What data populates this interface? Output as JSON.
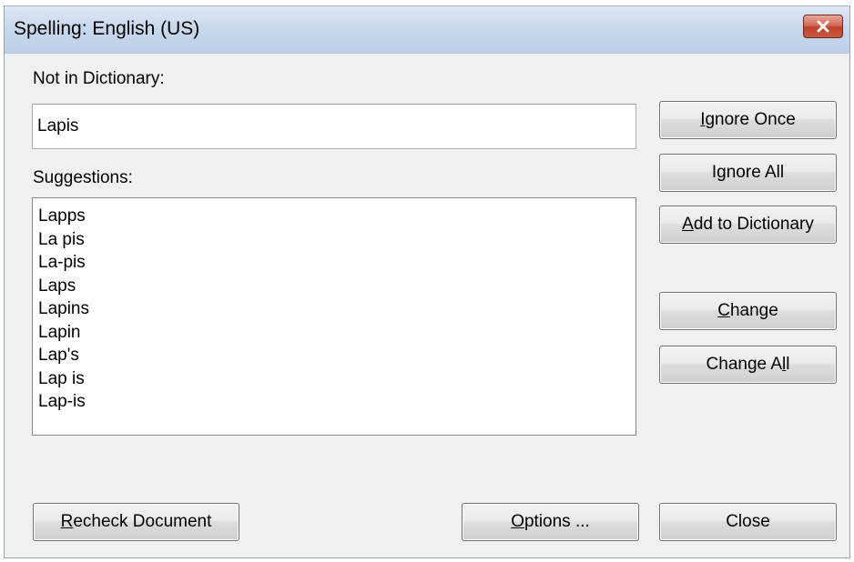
{
  "window": {
    "title": "Spelling: English (US)",
    "close_icon": "close-icon"
  },
  "not_in_dictionary": {
    "label": "Not in Dictionary:",
    "value": "Lapis"
  },
  "suggestions": {
    "label": "Suggestions:",
    "items": [
      "Lapps",
      "La pis",
      "La-pis",
      "Laps",
      "Lapins",
      "Lapin",
      "Lap's",
      "Lap is",
      "Lap-is"
    ]
  },
  "buttons": {
    "ignore_once": {
      "accel": "I",
      "rest": "gnore Once"
    },
    "ignore_all": {
      "pre": "I",
      "accel": "g",
      "rest": "nore All"
    },
    "add_to_dictionary": {
      "accel": "A",
      "rest": "dd to Dictionary"
    },
    "change": {
      "accel": "C",
      "rest": "hange"
    },
    "change_all": {
      "pre": "Change A",
      "accel": "l",
      "rest": "l"
    },
    "recheck_document": {
      "accel": "R",
      "rest": "echeck Document"
    },
    "options": {
      "accel": "O",
      "rest": "ptions ..."
    },
    "close": "Close"
  },
  "colors": {
    "close_button": "#c7432e",
    "dialog_bg": "#f0f0f0",
    "titlebar": "#c6d8ec"
  }
}
